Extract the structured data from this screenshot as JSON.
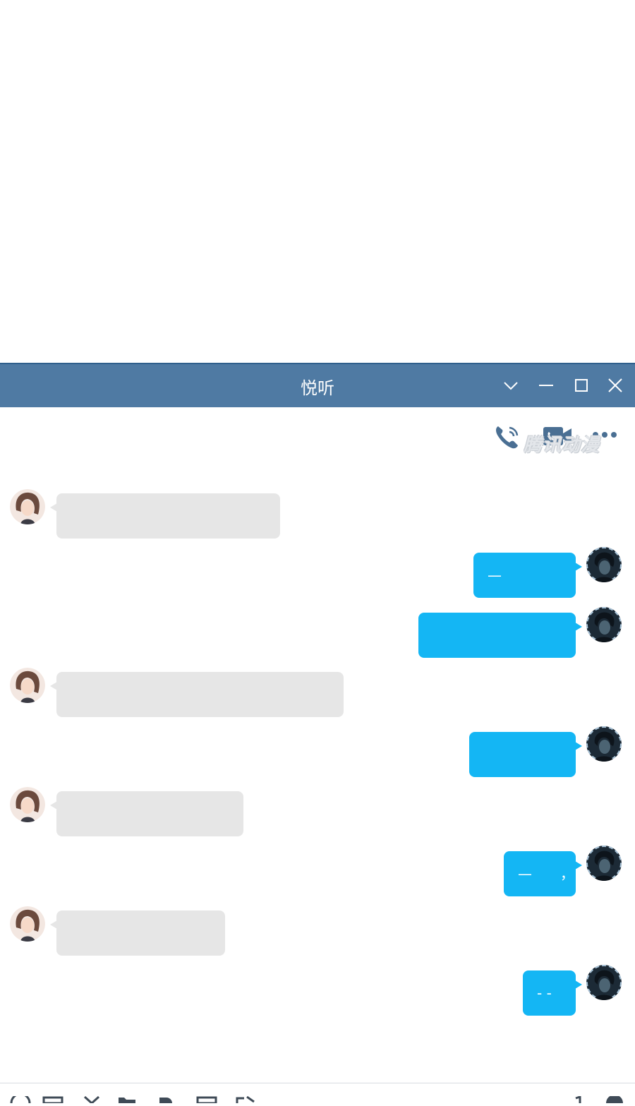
{
  "window": {
    "title": "悦听",
    "colors": {
      "titlebar": "#4f7aa3",
      "incoming_bubble": "#e6e6e6",
      "outgoing_bubble": "#14b6f4"
    }
  },
  "toolbar": {
    "icons": [
      "phone-icon",
      "video-call-icon",
      "more-icon"
    ]
  },
  "watermark": {
    "text": "腾讯动漫"
  },
  "messages": [
    {
      "side": "in",
      "text": ""
    },
    {
      "side": "out",
      "text": "—"
    },
    {
      "side": "out",
      "text": ""
    },
    {
      "side": "in",
      "text": ""
    },
    {
      "side": "out",
      "text": ""
    },
    {
      "side": "in",
      "text": ""
    },
    {
      "side": "out",
      "text": "—　　，"
    },
    {
      "side": "in",
      "text": ""
    },
    {
      "side": "out",
      "text": "- -"
    }
  ],
  "bottombar": {
    "icons": [
      "emoji-icon",
      "screenshot-icon",
      "scissors-icon",
      "folder-icon",
      "image-icon",
      "message-icon",
      "history-icon",
      "record-icon",
      "help-icon"
    ]
  }
}
